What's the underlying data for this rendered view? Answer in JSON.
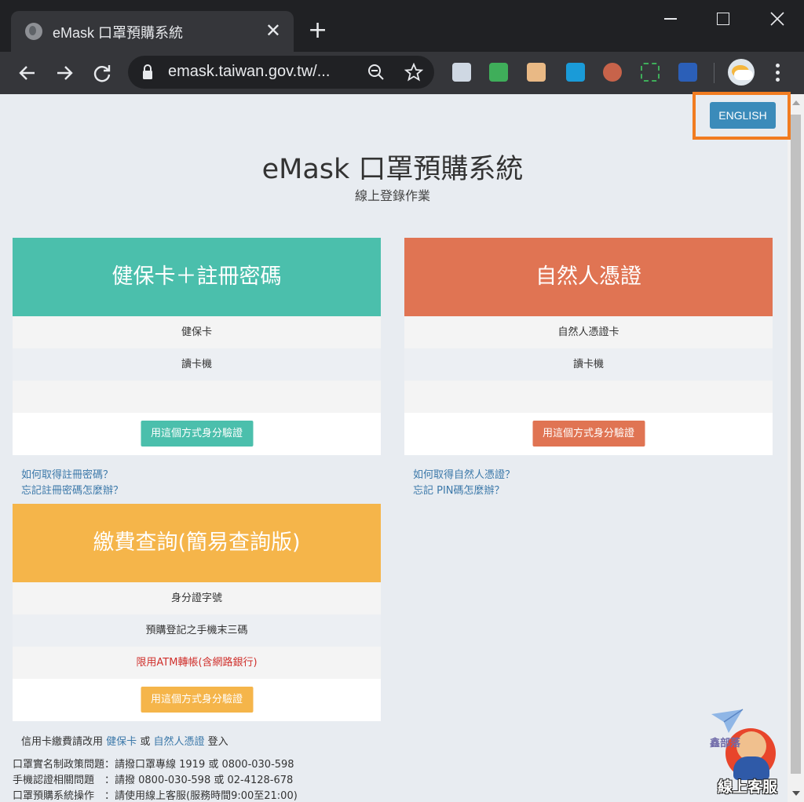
{
  "browser": {
    "tab_title": "eMask 口罩預購系統",
    "tab_close": "✕",
    "new_tab": "+",
    "url": "emask.taiwan.gov.tw/...",
    "colors": {
      "frame": "#202124",
      "toolbar": "#35363a"
    }
  },
  "page": {
    "lang_button": "ENGLISH",
    "title": "eMask 口罩預購系統",
    "subtitle": "線上登錄作業",
    "cards": {
      "nhi": {
        "header": "健保卡＋註冊密碼",
        "rows": [
          "健保卡",
          "讀卡機",
          ""
        ],
        "button": "用這個方式身分驗證",
        "links": [
          "如何取得註冊密碼？",
          "忘記註冊密碼怎麼辦？"
        ],
        "color": "#4bbfac"
      },
      "cert": {
        "header": "自然人憑證",
        "rows": [
          "自然人憑證卡",
          "讀卡機",
          ""
        ],
        "button": "用這個方式身分驗證",
        "links": [
          "如何取得自然人憑證？",
          "忘記 PIN碼怎麼辦？"
        ],
        "color": "#e07453"
      },
      "payment": {
        "header": "繳費查詢(簡易查詢版)",
        "rows": [
          "身分證字號",
          "預購登記之手機末三碼",
          "限用ATM轉帳(含網路銀行)"
        ],
        "button": "用這個方式身分驗證",
        "color": "#f5b54a"
      }
    },
    "credit_note": {
      "prefix": "信用卡繳費請改用",
      "link1": "健保卡",
      "or": "或",
      "link2": "自然人憑證",
      "suffix": "登入"
    },
    "contacts": [
      "口罩實名制政策問題：請撥口罩專線 1919 或 0800-030-598",
      "手機認證相關問題　：請撥 0800-030-598 或 02-4128-678",
      "口罩預購系統操作　：請使用線上客服(服務時間9:00至21:00)"
    ],
    "support": {
      "brand": "鑫部落",
      "label": "線上客服"
    }
  }
}
